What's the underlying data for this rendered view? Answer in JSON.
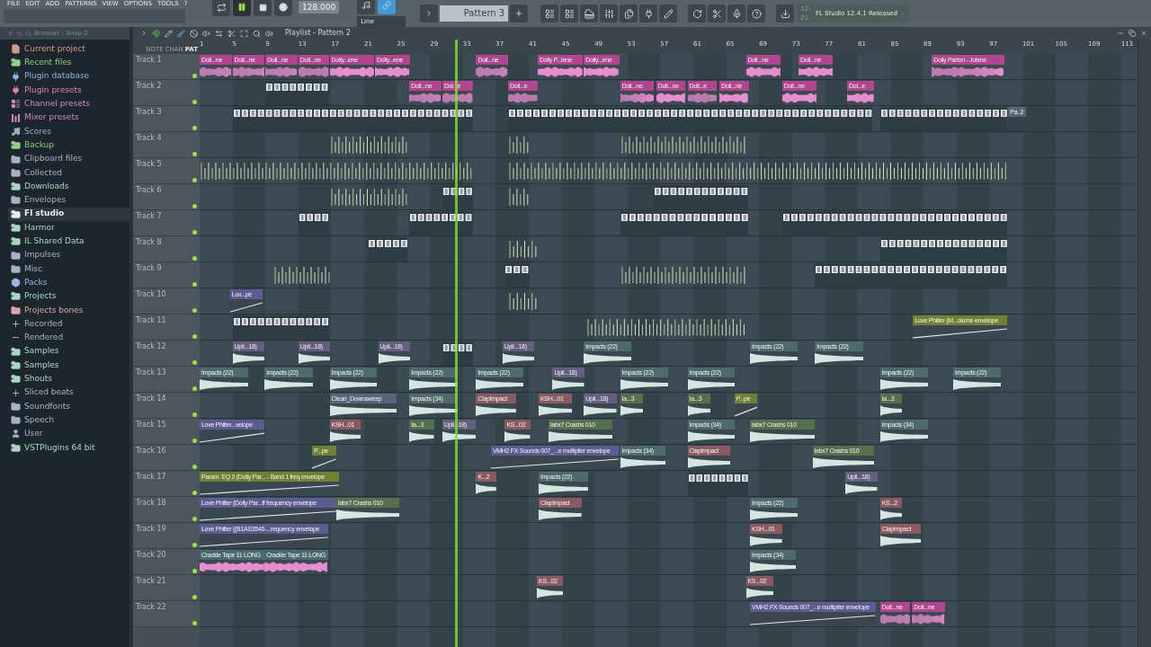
{
  "menu": [
    "FILE",
    "EDIT",
    "ADD",
    "PATTERNS",
    "VIEW",
    "OPTIONS",
    "TOOLS",
    "?"
  ],
  "transport": {
    "playing": true,
    "tempo": "128.000",
    "snap": "Line",
    "pattern": "Pattern 3"
  },
  "news": {
    "date": "12-21",
    "text": "FL Studio 12.4.1 Released"
  },
  "browser": {
    "title": "Browser - Snap 2",
    "items": [
      {
        "label": "Current project",
        "kind": "file",
        "color": "#d89a84",
        "selected": false
      },
      {
        "label": "Recent files",
        "kind": "folder-link",
        "color": "#8fd08a",
        "selected": false
      },
      {
        "label": "Plugin database",
        "kind": "plugin",
        "color": "#8db2e0",
        "selected": false
      },
      {
        "label": "Plugin presets",
        "kind": "plugin",
        "color": "#e084b4",
        "selected": false
      },
      {
        "label": "Channel presets",
        "kind": "channel",
        "color": "#d48cc4",
        "selected": false
      },
      {
        "label": "Mixer presets",
        "kind": "mixer",
        "color": "#c88cc4",
        "selected": false
      },
      {
        "label": "Scores",
        "kind": "note",
        "color": "#a4adb6",
        "selected": false
      },
      {
        "label": "Backup",
        "kind": "folder-link",
        "color": "#8fd08a",
        "selected": false
      },
      {
        "label": "Clipboard files",
        "kind": "folder",
        "color": "#a4b4c4",
        "selected": false
      },
      {
        "label": "Collected",
        "kind": "folder",
        "color": "#a4b4c4",
        "selected": false
      },
      {
        "label": "Downloads",
        "kind": "folder-link",
        "color": "#a8d8c0",
        "selected": false
      },
      {
        "label": "Envelopes",
        "kind": "folder",
        "color": "#a4b4c4",
        "selected": false
      },
      {
        "label": "Fl studio",
        "kind": "folder-link",
        "color": "#e8eef2",
        "selected": true
      },
      {
        "label": "Harmor",
        "kind": "folder-link",
        "color": "#a8d8c0",
        "selected": false
      },
      {
        "label": "IL Shared Data",
        "kind": "folder-link",
        "color": "#a8d8c0",
        "selected": false
      },
      {
        "label": "Impulses",
        "kind": "folder",
        "color": "#a4b4c4",
        "selected": false
      },
      {
        "label": "Misc",
        "kind": "folder",
        "color": "#a4b4c4",
        "selected": false
      },
      {
        "label": "Packs",
        "kind": "packs",
        "color": "#9cb4e4",
        "selected": false
      },
      {
        "label": "Projects",
        "kind": "folder-link",
        "color": "#a8d8c0",
        "selected": false
      },
      {
        "label": "Projects bones",
        "kind": "folder",
        "color": "#d8a8a8",
        "selected": false
      },
      {
        "label": "Recorded",
        "kind": "recorded",
        "color": "#a4b4c4",
        "selected": false
      },
      {
        "label": "Rendered",
        "kind": "rendered",
        "color": "#a4b4c4",
        "selected": false
      },
      {
        "label": "Samples",
        "kind": "folder-link",
        "color": "#a8d8c0",
        "selected": false
      },
      {
        "label": "Samples",
        "kind": "folder-link",
        "color": "#a8d8c0",
        "selected": false
      },
      {
        "label": "Shouts",
        "kind": "folder-link",
        "color": "#a8d8c0",
        "selected": false
      },
      {
        "label": "Sliced beats",
        "kind": "recorded",
        "color": "#a4b4c4",
        "selected": false
      },
      {
        "label": "Soundfonts",
        "kind": "folder",
        "color": "#a4b4c4",
        "selected": false
      },
      {
        "label": "Speech",
        "kind": "folder",
        "color": "#a4b4c4",
        "selected": false
      },
      {
        "label": "User",
        "kind": "user",
        "color": "#a4b4c4",
        "selected": false
      },
      {
        "label": "VSTPlugins 64 bit",
        "kind": "folder-link",
        "color": "#a8d8c0",
        "selected": false
      }
    ]
  },
  "playlist": {
    "title": "Playlist - Pattern 2",
    "modes": [
      {
        "label": "NOTE",
        "selected": false
      },
      {
        "label": "CHAN",
        "selected": false
      },
      {
        "label": "PAT",
        "selected": true
      }
    ],
    "ruler": [
      "1",
      "5",
      "9",
      "13",
      "17",
      "21",
      "25",
      "29",
      "33",
      "37",
      "41",
      "45",
      "49",
      "53",
      "57",
      "61",
      "65",
      "69",
      "73",
      "77",
      "81",
      "85",
      "89",
      "93",
      "97",
      "101",
      "105",
      "109",
      "113"
    ],
    "playhead": {
      "level": 0.272
    },
    "tracks": [
      {
        "name": "Track 1",
        "clips": [
          {
            "kind": "audio",
            "label": "Doll...ne",
            "color": "#b0468f"
          },
          {
            "kind": "audio",
            "label": "Doll...ne",
            "color": "#b0468f"
          },
          {
            "kind": "audio",
            "label": "Doll...ne",
            "color": "#b0468f"
          },
          {
            "kind": "audio",
            "label": "Doll...ne",
            "color": "#b0468f"
          },
          {
            "kind": "audio",
            "label": "Dolly...ene",
            "color": "#b0468f"
          },
          {
            "kind": "audio",
            "label": "Dolly...ene",
            "color": "#b0468f"
          },
          {
            "kind": "audio",
            "label": "Doll...ne",
            "color": "#b0468f"
          },
          {
            "kind": "audio",
            "label": "Dolly P...lene",
            "color": "#b0468f"
          },
          {
            "kind": "audio",
            "label": "Dolly...ene",
            "color": "#b0468f"
          },
          {
            "kind": "audio",
            "label": "Doll...ne",
            "color": "#b0468f"
          },
          {
            "kind": "audio",
            "label": "Doll...ne",
            "color": "#b0468f"
          },
          {
            "kind": "audio",
            "label": "Dolly Parton - Jolene",
            "color": "#b0468f"
          }
        ]
      },
      {
        "name": "Track 2",
        "clips": [
          {
            "kind": "pattern"
          },
          {
            "kind": "audio",
            "label": "Doll...ne",
            "color": "#b0468f"
          },
          {
            "kind": "audio",
            "label": "Dol...e",
            "color": "#b0468f"
          },
          {
            "kind": "audio",
            "label": "Doll...e",
            "color": "#b0468f"
          },
          {
            "kind": "audio",
            "label": "Doll...ne",
            "color": "#b0468f"
          },
          {
            "kind": "audio",
            "label": "Doll...ne",
            "color": "#b0468f"
          },
          {
            "kind": "audio",
            "label": "Doll...e",
            "color": "#b0468f"
          },
          {
            "kind": "audio",
            "label": "Doll...ne",
            "color": "#b0468f"
          },
          {
            "kind": "audio",
            "label": "Doll...ne",
            "color": "#b0468f"
          },
          {
            "kind": "audio",
            "label": "Dol...e",
            "color": "#b0468f"
          }
        ]
      },
      {
        "name": "Track 3",
        "clips": [
          {
            "kind": "pattern"
          },
          {
            "kind": "pattern"
          },
          {
            "kind": "pattern"
          },
          {
            "kind": "pattern",
            "label": "Pa..2",
            "color": "#5a6670"
          }
        ]
      },
      {
        "name": "Track 4",
        "clips": [
          {
            "kind": "hits"
          },
          {
            "kind": "hits"
          },
          {
            "kind": "hits"
          }
        ]
      },
      {
        "name": "Track 5",
        "clips": [
          {
            "kind": "hits"
          },
          {
            "kind": "hits"
          }
        ]
      },
      {
        "name": "Track 6",
        "clips": [
          {
            "kind": "hits"
          },
          {
            "kind": "pattern"
          },
          {
            "kind": "hits"
          },
          {
            "kind": "pattern"
          }
        ]
      },
      {
        "name": "Track 7",
        "clips": [
          {
            "kind": "pattern"
          },
          {
            "kind": "pattern"
          },
          {
            "kind": "pattern"
          },
          {
            "kind": "pattern"
          }
        ]
      },
      {
        "name": "Track 8",
        "clips": [
          {
            "kind": "pattern"
          },
          {
            "kind": "hits"
          },
          {
            "kind": "pattern"
          }
        ]
      },
      {
        "name": "Track 9",
        "clips": [
          {
            "kind": "hits"
          },
          {
            "kind": "pattern"
          },
          {
            "kind": "hits"
          },
          {
            "kind": "pattern"
          }
        ]
      },
      {
        "name": "Track 10",
        "clips": [
          {
            "kind": "automation",
            "label": "Lov...pe",
            "color": "#5c5c92"
          },
          {
            "kind": "hits"
          }
        ]
      },
      {
        "name": "Track 11",
        "clips": [
          {
            "kind": "pattern"
          },
          {
            "kind": "hits"
          },
          {
            "kind": "automation",
            "label": "Love Philter (M...olume envelope",
            "color": "#6e8232"
          }
        ]
      },
      {
        "name": "Track 12",
        "clips": [
          {
            "kind": "sample",
            "label": "Upli...18)",
            "color": "#62607e"
          },
          {
            "kind": "sample",
            "label": "Upli...18)",
            "color": "#62607e"
          },
          {
            "kind": "sample",
            "label": "Upli...18)",
            "color": "#62607e"
          },
          {
            "kind": "pattern"
          },
          {
            "kind": "sample",
            "label": "Upli...18)",
            "color": "#62607e"
          },
          {
            "kind": "sample",
            "label": "Impacts (22)",
            "color": "#4f6a6c"
          },
          {
            "kind": "sample",
            "label": "Impacts (22)",
            "color": "#4f6a6c"
          },
          {
            "kind": "sample",
            "label": "Impacts (22)",
            "color": "#4f6a6c"
          }
        ]
      },
      {
        "name": "Track 13",
        "clips": [
          {
            "kind": "sample",
            "label": "Impacts (22)",
            "color": "#4f6a6c"
          },
          {
            "kind": "sample",
            "label": "Impacts (22)",
            "color": "#4f6a6c"
          },
          {
            "kind": "sample",
            "label": "Impacts (22)",
            "color": "#4f6a6c"
          },
          {
            "kind": "sample",
            "label": "Impacts (22)",
            "color": "#4f6a6c"
          },
          {
            "kind": "sample",
            "label": "Impacts (22)",
            "color": "#4f6a6c"
          },
          {
            "kind": "sample",
            "label": "Upli...18)",
            "color": "#62607e"
          },
          {
            "kind": "sample",
            "label": "Impacts (22)",
            "color": "#4f6a6c"
          },
          {
            "kind": "sample",
            "label": "Impacts (22)",
            "color": "#4f6a6c"
          },
          {
            "kind": "sample",
            "label": "Impacts (22)",
            "color": "#4f6a6c"
          },
          {
            "kind": "sample",
            "label": "Impacts (22)",
            "color": "#4f6a6c"
          }
        ]
      },
      {
        "name": "Track 14",
        "clips": [
          {
            "kind": "sample",
            "label": "Clean_Downsweep",
            "color": "#56667a"
          },
          {
            "kind": "sample",
            "label": "Impacts (34)",
            "color": "#4f6a6c"
          },
          {
            "kind": "sample",
            "label": "ClapImpact",
            "color": "#8a5a62"
          },
          {
            "kind": "sample",
            "label": "KSH...01",
            "color": "#8a5a62"
          },
          {
            "kind": "sample",
            "label": "Upli...18)",
            "color": "#62607e"
          },
          {
            "kind": "sample",
            "label": "Ia...3",
            "color": "#56704e"
          },
          {
            "kind": "sample",
            "label": "Ia...3",
            "color": "#56704e"
          },
          {
            "kind": "automation",
            "label": "P...pe",
            "color": "#6e8232"
          },
          {
            "kind": "sample",
            "label": "Ia...3",
            "color": "#56704e"
          }
        ]
      },
      {
        "name": "Track 15",
        "clips": [
          {
            "kind": "automation",
            "label": "Love Philter...velope",
            "color": "#5c5c92"
          },
          {
            "kind": "sample",
            "label": "KSH...01",
            "color": "#8a5a62"
          },
          {
            "kind": "sample",
            "label": "Ia...3",
            "color": "#56704e"
          },
          {
            "kind": "sample",
            "label": "Upli...18)",
            "color": "#62607e"
          },
          {
            "kind": "sample",
            "label": "KS...02",
            "color": "#8a5a62"
          },
          {
            "kind": "sample",
            "label": "labx7 Crashs 010",
            "color": "#56704e"
          },
          {
            "kind": "sample",
            "label": "Impacts (34)",
            "color": "#4f6a6c"
          },
          {
            "kind": "sample",
            "label": "labx7 Crashs 010",
            "color": "#56704e"
          },
          {
            "kind": "sample",
            "label": "Impacts (34)",
            "color": "#4f6a6c"
          }
        ]
      },
      {
        "name": "Track 16",
        "clips": [
          {
            "kind": "automation",
            "label": "P...pe",
            "color": "#6e8232"
          },
          {
            "kind": "automation",
            "label": "VMH2 FX Sounds 007_...e multiplier envelope",
            "color": "#5c5c92"
          },
          {
            "kind": "sample",
            "label": "Impacts (34)",
            "color": "#4f6a6c"
          },
          {
            "kind": "sample",
            "label": "ClapImpact",
            "color": "#8a5a62"
          },
          {
            "kind": "sample",
            "label": "labx7 Crashs 010",
            "color": "#56704e"
          }
        ]
      },
      {
        "name": "Track 17",
        "clips": [
          {
            "kind": "automation",
            "label": "Param. EQ 2 (Dolly Par... - Band 1 freq envelope",
            "color": "#6e8232"
          },
          {
            "kind": "sample",
            "label": "K...2",
            "color": "#8a5a62"
          },
          {
            "kind": "sample",
            "label": "Impacts (22)",
            "color": "#4f6a6c"
          },
          {
            "kind": "pattern"
          },
          {
            "kind": "sample",
            "label": "Upli...18)",
            "color": "#62607e"
          }
        ]
      },
      {
        "name": "Track 18",
        "clips": [
          {
            "kind": "automation",
            "label": "Love Philter (Dolly Par...ff frequency envelope",
            "color": "#5c5c92"
          },
          {
            "kind": "sample",
            "label": "labx7 Crashs 010",
            "color": "#56704e"
          },
          {
            "kind": "sample",
            "label": "ClapImpact",
            "color": "#8a5a62"
          },
          {
            "kind": "sample",
            "label": "Impacts (22)",
            "color": "#4f6a6c"
          },
          {
            "kind": "sample",
            "label": "KS...2",
            "color": "#8a5a62"
          }
        ]
      },
      {
        "name": "Track 19",
        "clips": [
          {
            "kind": "automation",
            "label": "Love Philter ((B1AS3545-...requency envelope",
            "color": "#5c5c92"
          },
          {
            "kind": "sample",
            "label": "KSH...01",
            "color": "#8a5a62"
          },
          {
            "kind": "sample",
            "label": "ClapImpact",
            "color": "#8a5a62"
          }
        ]
      },
      {
        "name": "Track 20",
        "clips": [
          {
            "kind": "audio",
            "label": "Crackle Tape 11 LONG",
            "color": "#4a6a70"
          },
          {
            "kind": "audio",
            "label": "Crackle Tape 11 LONG",
            "color": "#4a6a70"
          },
          {
            "kind": "sample",
            "label": "Impacts (34)",
            "color": "#4f6a6c"
          }
        ]
      },
      {
        "name": "Track 21",
        "clips": [
          {
            "kind": "sample",
            "label": "KS...02",
            "color": "#8a5a62"
          },
          {
            "kind": "sample",
            "label": "KS...02",
            "color": "#8a5a62"
          }
        ]
      },
      {
        "name": "Track 22",
        "clips": [
          {
            "kind": "automation",
            "label": "VMH2 FX Sounds 007_...e multiplier envelope",
            "color": "#5c5c92"
          },
          {
            "kind": "audio",
            "label": "Doll...ne",
            "color": "#b0468f"
          },
          {
            "kind": "audio",
            "label": "Doll...ne",
            "color": "#b0468f"
          }
        ]
      }
    ]
  }
}
